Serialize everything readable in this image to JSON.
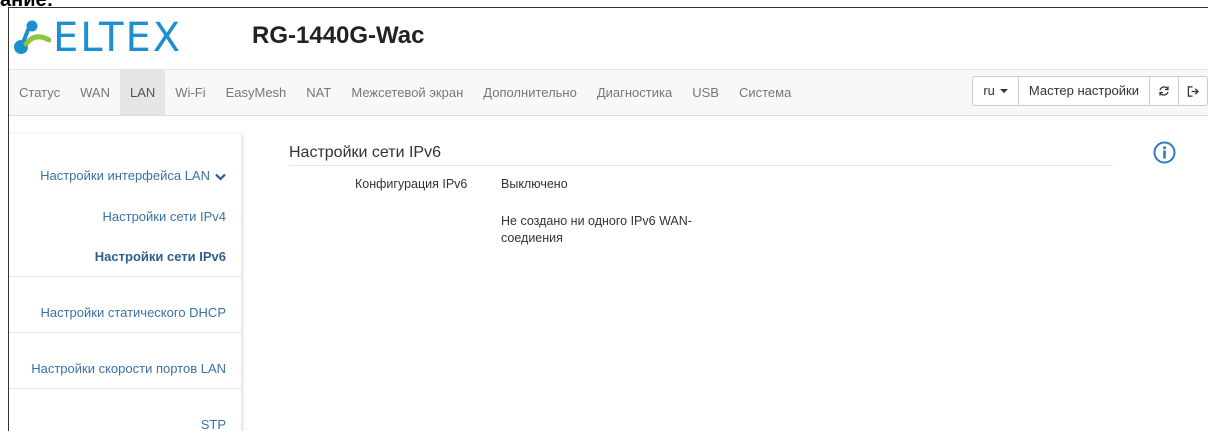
{
  "clipped_heading": "ание:",
  "header": {
    "logo_text": "ELTEX",
    "model": "RG-1440G-Wac"
  },
  "nav": {
    "items": [
      {
        "label": "Статус"
      },
      {
        "label": "WAN"
      },
      {
        "label": "LAN",
        "active": true
      },
      {
        "label": "Wi-Fi"
      },
      {
        "label": "EasyMesh"
      },
      {
        "label": "NAT"
      },
      {
        "label": "Межсетевой экран"
      },
      {
        "label": "Дополнительно"
      },
      {
        "label": "Диагностика"
      },
      {
        "label": "USB"
      },
      {
        "label": "Система"
      }
    ],
    "language": "ru",
    "wizard": "Мастер настройки"
  },
  "sidebar": {
    "group_label": "Настройки интерфейса LAN",
    "ipv4": "Настройки сети IPv4",
    "ipv6": "Настройки сети IPv6",
    "static_dhcp": "Настройки статического DHCP",
    "port_speed": "Настройки скорости портов LAN",
    "stp": "STP"
  },
  "main": {
    "title": "Настройки сети IPv6",
    "config_label": "Конфигурация IPv6",
    "config_value": "Выключено",
    "note": "Не создано ни одного IPv6 WAN-соедиения"
  },
  "colors": {
    "brand": "#1b8fd2",
    "link": "#3a72a8"
  },
  "icons": [
    "logo-icon",
    "chevron-down-icon",
    "refresh-icon",
    "logout-icon",
    "info-icon"
  ]
}
